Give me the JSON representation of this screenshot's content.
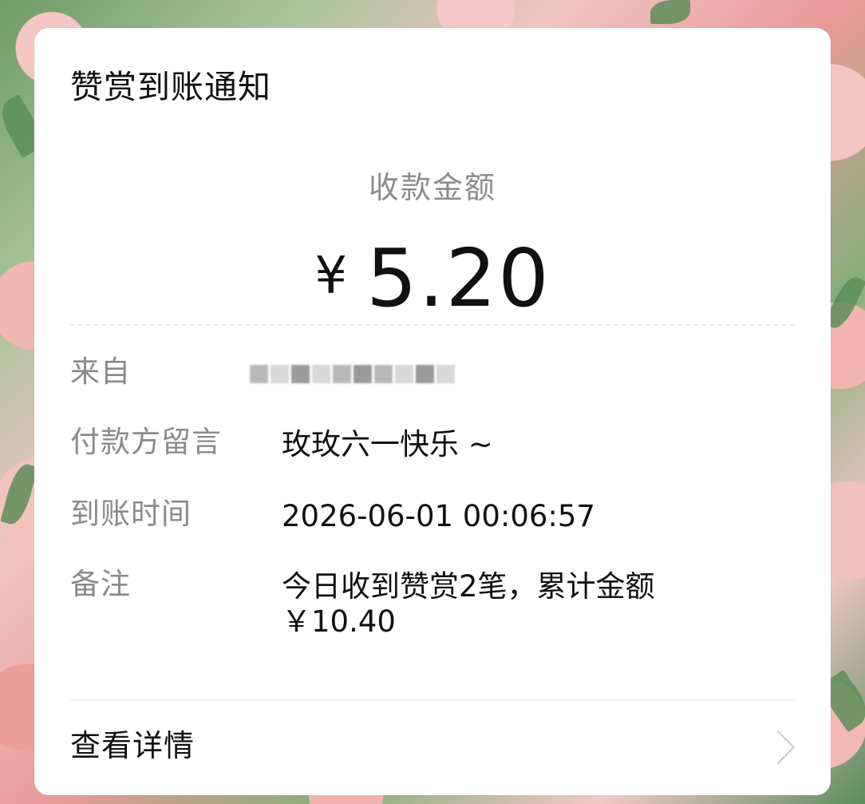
{
  "notification": {
    "title": "赞赏到账通知",
    "amount_label": "收款金额",
    "currency_symbol": "¥",
    "amount": "5.20",
    "rows": [
      {
        "label": "来自",
        "value": ""
      },
      {
        "label": "付款方留言",
        "value": "玫玫六一快乐 ~"
      },
      {
        "label": "到账时间",
        "value": "2026-06-01 00:06:57"
      },
      {
        "label": "备注",
        "value": "今日收到赞赏2笔，累计金额\n￥10.40"
      }
    ],
    "detail_label": "查看详情"
  },
  "colors": {
    "card_background": "#ffffff",
    "label_text": "#8a8a8a",
    "primary_text": "#111111",
    "divider": "#ececec"
  },
  "icons": {
    "detail_chevron": "chevron-right-icon"
  }
}
